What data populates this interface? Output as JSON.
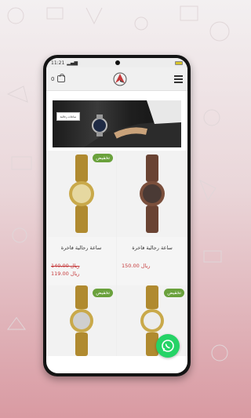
{
  "status_bar": {
    "time": "11:21"
  },
  "header": {
    "cart_count": "0"
  },
  "banner": {
    "label": "ساعات رجالية"
  },
  "products": [
    {
      "title": "ساعة رجالية فاخرة",
      "price": "150.00 ريال",
      "old_price": "",
      "badge": ""
    },
    {
      "title": "ساعة رجالية فاخرة",
      "price": "119.00 ريال",
      "old_price": "140.00 ريال",
      "badge": "تخفيض"
    },
    {
      "title": "",
      "price": "",
      "old_price": "",
      "badge": "تخفيض"
    },
    {
      "title": "",
      "price": "",
      "old_price": "",
      "badge": "تخفيض"
    }
  ],
  "colors": {
    "accent": "#c5383a",
    "badge": "#6aa13c",
    "whatsapp": "#25d366"
  },
  "icons": [
    "cart-icon",
    "menu-icon",
    "whatsapp-icon",
    "logo-icon"
  ]
}
